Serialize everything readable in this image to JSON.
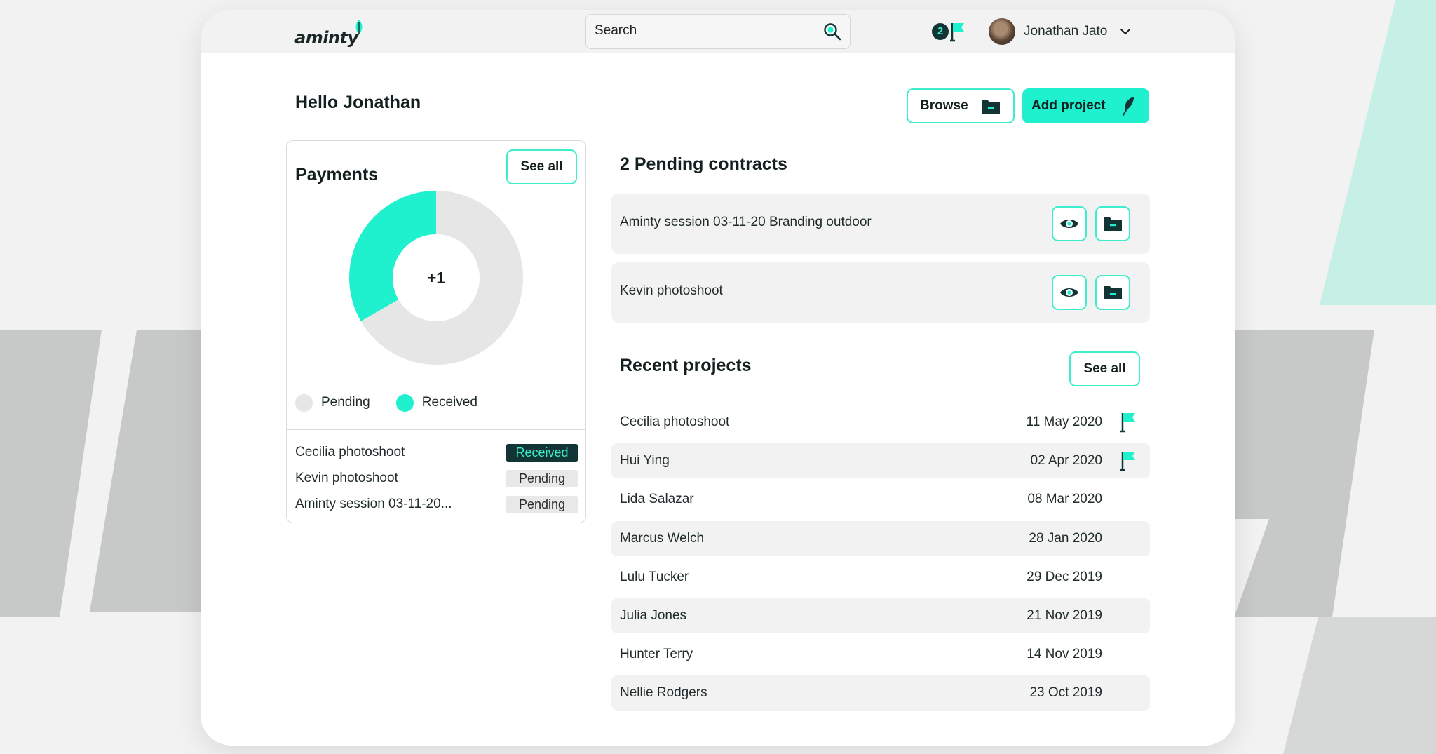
{
  "app": {
    "logo_text": "aminty",
    "search_placeholder": "Search",
    "notification_count": "2",
    "user_name": "Jonathan Jato"
  },
  "header": {
    "greeting": "Hello Jonathan",
    "browse_label": "Browse",
    "add_project_label": "Add project"
  },
  "colors": {
    "accent": "#1ff0cd",
    "accent_border": "#3ceecb",
    "dark": "#123434",
    "pending_gray": "#e6e6e6"
  },
  "payments": {
    "title": "Payments",
    "see_all_label": "See all",
    "center_label": "+1",
    "legend": [
      {
        "label": "Pending",
        "color": "#e6e6e6"
      },
      {
        "label": "Received",
        "color": "#1ff0cd"
      }
    ],
    "chart_data": {
      "type": "pie",
      "categories": [
        "Pending",
        "Received"
      ],
      "values": [
        2,
        1
      ],
      "colors": [
        "#e6e6e6",
        "#1ff0cd"
      ]
    },
    "items": [
      {
        "name": "Cecilia photoshoot",
        "status": "Received"
      },
      {
        "name": "Kevin photoshoot",
        "status": "Pending"
      },
      {
        "name": "Aminty session 03-11-20...",
        "status": "Pending"
      }
    ]
  },
  "contracts": {
    "title": "2 Pending contracts",
    "items": [
      {
        "name": "Aminty session 03-11-20 Branding outdoor"
      },
      {
        "name": "Kevin photoshoot"
      }
    ]
  },
  "recent": {
    "title": "Recent projects",
    "see_all_label": "See all",
    "items": [
      {
        "name": "Cecilia photoshoot",
        "date": "11 May 2020",
        "flagged": true
      },
      {
        "name": "Hui Ying",
        "date": "02 Apr 2020",
        "flagged": true
      },
      {
        "name": "Lida Salazar",
        "date": "08 Mar 2020",
        "flagged": false
      },
      {
        "name": "Marcus Welch",
        "date": "28 Jan 2020",
        "flagged": false
      },
      {
        "name": "Lulu Tucker",
        "date": "29 Dec 2019",
        "flagged": false
      },
      {
        "name": "Julia Jones",
        "date": "21 Nov 2019",
        "flagged": false
      },
      {
        "name": "Hunter Terry",
        "date": "14 Nov 2019",
        "flagged": false
      },
      {
        "name": "Nellie Rodgers",
        "date": "23 Oct 2019",
        "flagged": false
      }
    ]
  }
}
